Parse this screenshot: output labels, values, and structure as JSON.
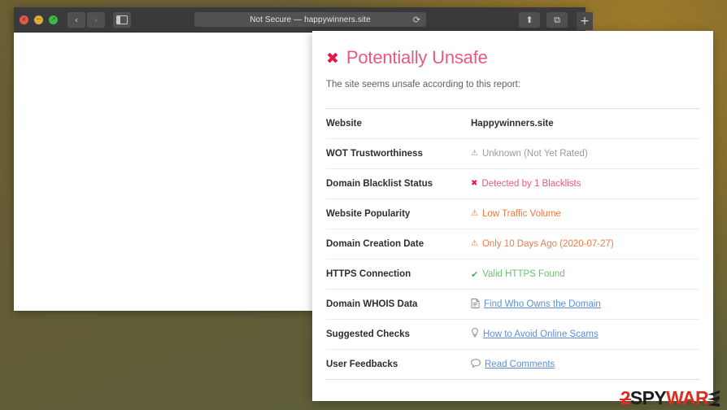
{
  "browser": {
    "traffic_lights": [
      {
        "name": "close",
        "glyph": "×",
        "color": "#e05a49"
      },
      {
        "name": "minimize",
        "glyph": "−",
        "color": "#e0a93b"
      },
      {
        "name": "maximize",
        "glyph": "↗",
        "color": "#3cb94a"
      }
    ],
    "back_glyph": "‹",
    "forward_glyph": "›",
    "sidebar_label": "show-sidebar",
    "address_text": "Not Secure — happywinners.site",
    "reload_glyph": "⟳",
    "share_glyph": "⬆",
    "tabs_glyph": "⧉",
    "new_tab_glyph": "+"
  },
  "report": {
    "heading_mark": "✖",
    "heading": "Potentially Unsafe",
    "subtitle": "The site seems unsafe according to this report:",
    "rows": [
      {
        "label": "Website",
        "icon": "",
        "icon_class": "",
        "value": "Happywinners.site",
        "value_class": "v-plain",
        "interactable": false
      },
      {
        "label": "WOT Trustworthiness",
        "icon": "⚠",
        "icon_class": "i-muted",
        "value": "Unknown (Not Yet Rated)",
        "value_class": "v-muted",
        "interactable": false
      },
      {
        "label": "Domain Blacklist Status",
        "icon": "✖",
        "icon_class": "i-danger",
        "value": "Detected by 1 Blacklists",
        "value_class": "v-danger",
        "interactable": false
      },
      {
        "label": "Website Popularity",
        "icon": "⚠",
        "icon_class": "i-warn",
        "value": "Low Traffic Volume",
        "value_class": "v-warn",
        "interactable": false
      },
      {
        "label": "Domain Creation Date",
        "icon": "⚠",
        "icon_class": "i-warn",
        "value": "Only 10 Days Ago (2020-07-27)",
        "value_class": "v-warn",
        "interactable": false
      },
      {
        "label": "HTTPS Connection",
        "icon": "✔",
        "icon_class": "i-ok",
        "value": "Valid HTTPS Found",
        "value_class": "v-ok",
        "interactable": false
      },
      {
        "label": "Domain WHOIS Data",
        "icon": "Ὄ4",
        "icon_class": "i-muted",
        "value": "Find Who Owns the Domain",
        "value_class": "v-link",
        "interactable": true
      },
      {
        "label": "Suggested Checks",
        "icon": " ",
        "icon_class": "i-muted",
        "value": "How to Avoid Online Scams",
        "value_class": "v-link",
        "interactable": true
      },
      {
        "label": "User Feedbacks",
        "icon": "○",
        "icon_class": "i-muted",
        "value": "Read Comments",
        "value_class": "v-link",
        "interactable": true
      }
    ]
  },
  "watermark": {
    "part1": "2",
    "part2": "SPY",
    "part3": "WAR",
    "part4": "E"
  }
}
